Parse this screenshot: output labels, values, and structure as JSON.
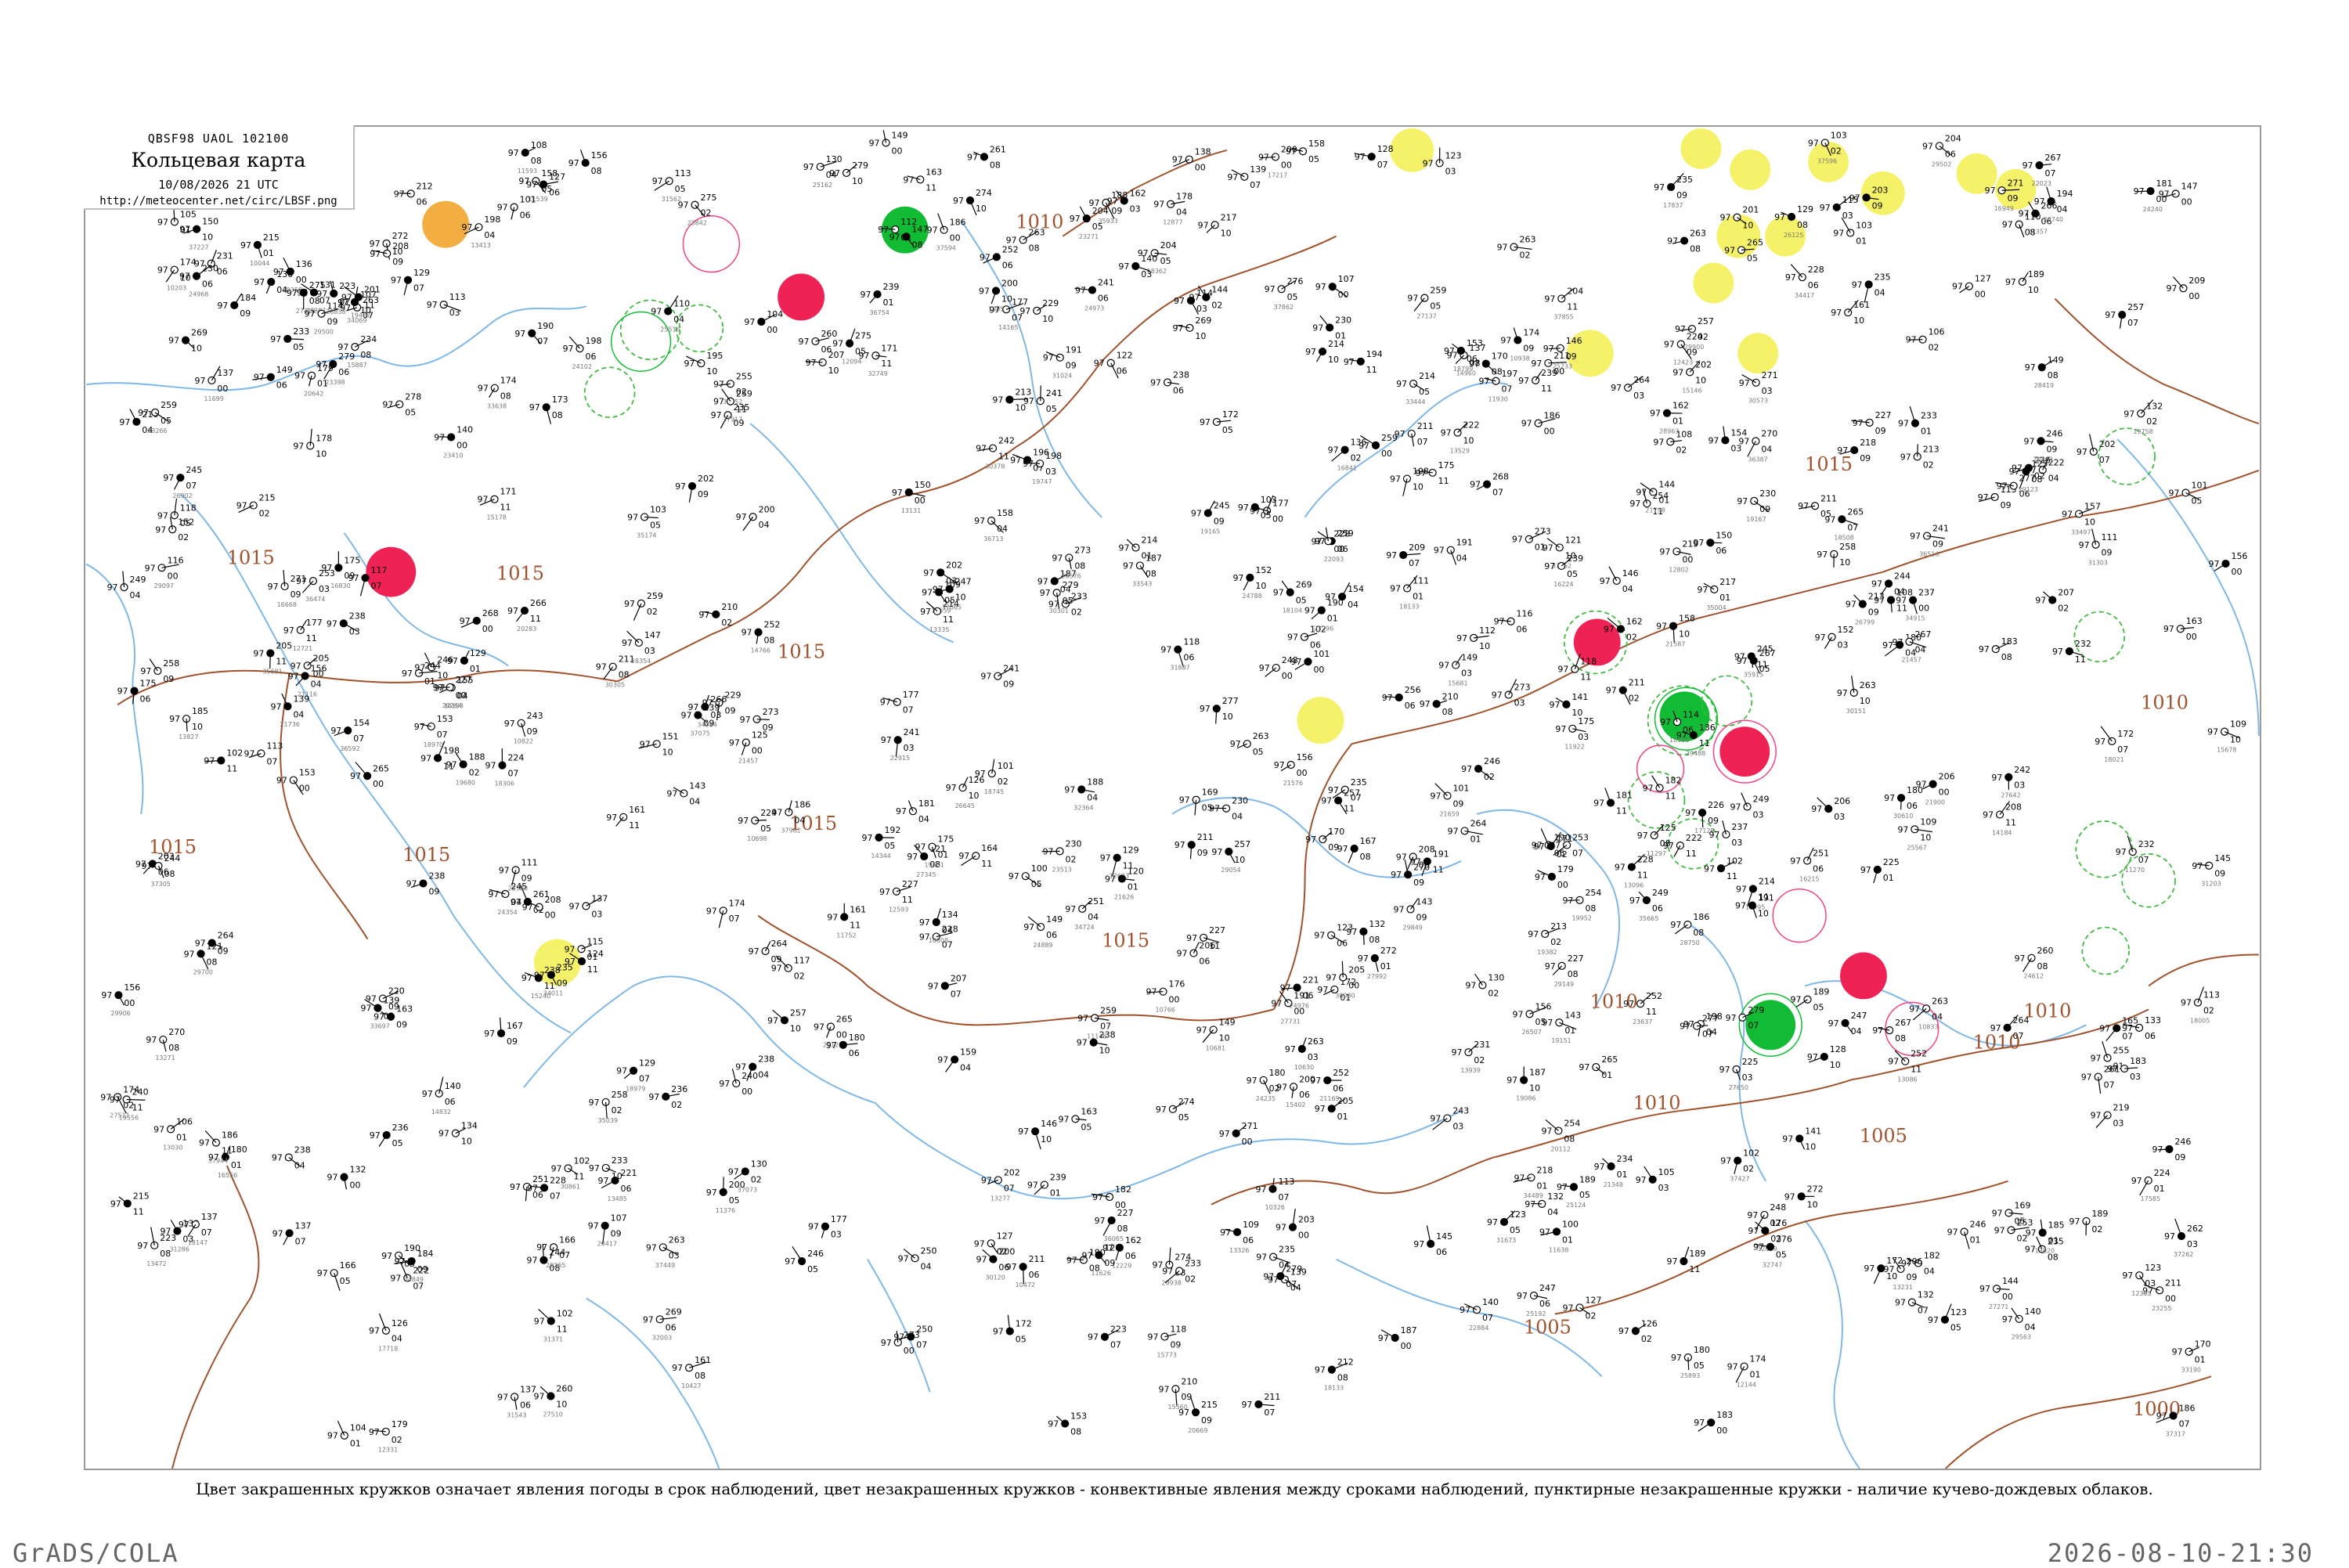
{
  "header": {
    "product_code": "QBSF98  UAOL  102100",
    "title": "Кольцевая карта",
    "valid_time": "10/08/2026 21 UTC",
    "source_url": "http://meteocenter.net/circ/LBSF.png"
  },
  "isobars": [
    "1010",
    "1015",
    "1015",
    "1015",
    "1015",
    "1015",
    "1015",
    "1015",
    "1015",
    "1010",
    "1010",
    "1010",
    "1005",
    "1005",
    "1010",
    "1010",
    "1000"
  ],
  "colors": {
    "coast": "#7fb8e8",
    "isobar": "#a0522d",
    "precip_now": "#ee2255",
    "convective_past": "#ee4488",
    "shower_cloud": "#44bb44",
    "thunder_now": "#11bb33",
    "fog_haze": "#f5f26a",
    "dust_smoke": "#f0a020"
  },
  "legend": {
    "caption": "Цвет закрашенных кружков означает явления погоды в срок наблюдений, цвет незакрашенных кружков - конвективные явления между сроками наблюдений, пунктирные незакрашенные кружки - наличие кучево-дождевых облаков."
  },
  "footer": {
    "engine": "GrADS/COLA",
    "timestamp": "2026-08-10-21:30"
  }
}
